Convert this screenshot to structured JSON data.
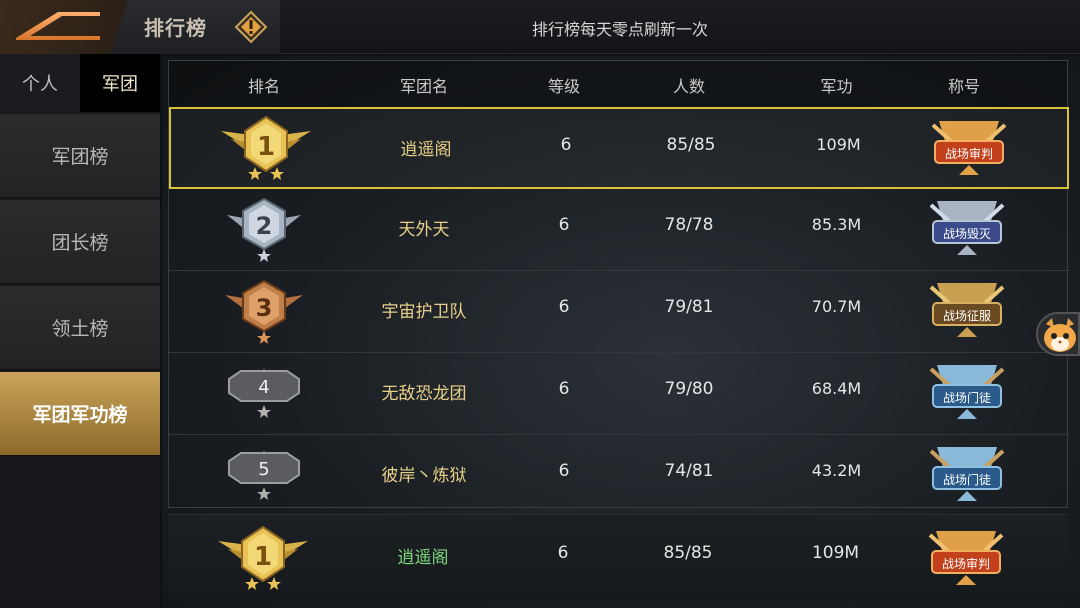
{
  "header": {
    "title": "排行榜",
    "notice": "排行榜每天零点刷新一次"
  },
  "sidebar": {
    "tabs": [
      {
        "label": "个人"
      },
      {
        "label": "军团"
      }
    ],
    "items": [
      {
        "label": "军团榜"
      },
      {
        "label": "团长榜"
      },
      {
        "label": "领土榜"
      },
      {
        "label": "军团军功榜"
      }
    ]
  },
  "table": {
    "columns": [
      "排名",
      "军团名",
      "等级",
      "人数",
      "军功",
      "称号"
    ],
    "rows": [
      {
        "rank": "1",
        "name": "逍遥阁",
        "level": "6",
        "people": "85/85",
        "merit": "109M",
        "title": "战场审判"
      },
      {
        "rank": "2",
        "name": "天外天",
        "level": "6",
        "people": "78/78",
        "merit": "85.3M",
        "title": "战场毁灭"
      },
      {
        "rank": "3",
        "name": "宇宙护卫队",
        "level": "6",
        "people": "79/81",
        "merit": "70.7M",
        "title": "战场征服"
      },
      {
        "rank": "4",
        "name": "无敌恐龙团",
        "level": "6",
        "people": "79/80",
        "merit": "68.4M",
        "title": "战场门徒"
      },
      {
        "rank": "5",
        "name": "彼岸丶炼狱",
        "level": "6",
        "people": "74/81",
        "merit": "43.2M",
        "title": "战场门徒"
      }
    ]
  },
  "my_row": {
    "rank": "1",
    "name": "逍遥阁",
    "level": "6",
    "people": "85/85",
    "merit": "109M",
    "title": "战场审判"
  },
  "colors": {
    "gold": "#d8c23a",
    "name_text": "#e8d08a",
    "my_name": "#7ed67e",
    "active_item": "#c9a45a"
  }
}
